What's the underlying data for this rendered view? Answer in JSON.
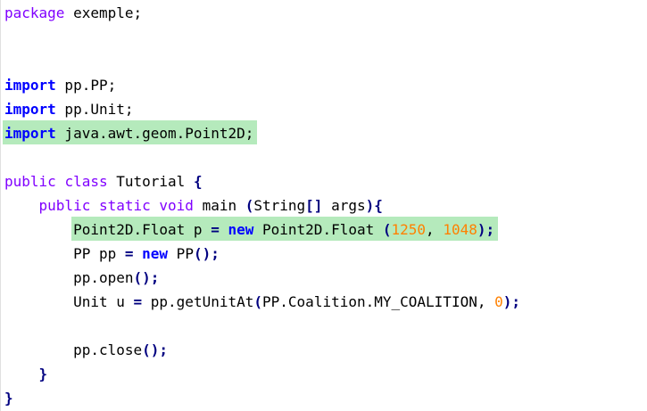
{
  "lines": [
    {
      "tokens": [
        {
          "t": "package",
          "c": "kw"
        },
        {
          "t": " exemple;",
          "c": "plain"
        }
      ]
    },
    {
      "tokens": []
    },
    {
      "tokens": []
    },
    {
      "tokens": [
        {
          "t": "import",
          "c": "kwb"
        },
        {
          "t": " pp.PP;",
          "c": "plain"
        }
      ]
    },
    {
      "tokens": [
        {
          "t": "import",
          "c": "kwb"
        },
        {
          "t": " pp.Unit;",
          "c": "plain"
        }
      ]
    },
    {
      "tokens": [
        {
          "t": "import",
          "c": "kwb"
        },
        {
          "t": " java.awt.geom.Point2D;",
          "c": "plain"
        }
      ]
    },
    {
      "tokens": []
    },
    {
      "tokens": [
        {
          "t": "public",
          "c": "kw"
        },
        {
          "t": " ",
          "c": "plain"
        },
        {
          "t": "class",
          "c": "kw"
        },
        {
          "t": " Tutorial ",
          "c": "plain"
        },
        {
          "t": "{",
          "c": "br"
        }
      ]
    },
    {
      "tokens": [
        {
          "t": "    ",
          "c": "plain"
        },
        {
          "t": "public",
          "c": "kw"
        },
        {
          "t": " ",
          "c": "plain"
        },
        {
          "t": "static",
          "c": "kw"
        },
        {
          "t": " ",
          "c": "plain"
        },
        {
          "t": "void",
          "c": "kw"
        },
        {
          "t": " main ",
          "c": "plain"
        },
        {
          "t": "(",
          "c": "br"
        },
        {
          "t": "String",
          "c": "plain"
        },
        {
          "t": "[]",
          "c": "br"
        },
        {
          "t": " args",
          "c": "plain"
        },
        {
          "t": "){",
          "c": "br"
        }
      ]
    },
    {
      "tokens": [
        {
          "t": "        Point2D.Float p ",
          "c": "plain"
        },
        {
          "t": "=",
          "c": "br"
        },
        {
          "t": " ",
          "c": "plain"
        },
        {
          "t": "new",
          "c": "kwb"
        },
        {
          "t": " Point2D.Float ",
          "c": "plain"
        },
        {
          "t": "(",
          "c": "br"
        },
        {
          "t": "1250",
          "c": "num"
        },
        {
          "t": ", ",
          "c": "plain"
        },
        {
          "t": "1048",
          "c": "num"
        },
        {
          "t": ");",
          "c": "br"
        }
      ]
    },
    {
      "tokens": [
        {
          "t": "        PP pp ",
          "c": "plain"
        },
        {
          "t": "=",
          "c": "br"
        },
        {
          "t": " ",
          "c": "plain"
        },
        {
          "t": "new",
          "c": "kwb"
        },
        {
          "t": " PP",
          "c": "plain"
        },
        {
          "t": "();",
          "c": "br"
        }
      ]
    },
    {
      "tokens": [
        {
          "t": "        pp.open",
          "c": "plain"
        },
        {
          "t": "();",
          "c": "br"
        }
      ]
    },
    {
      "tokens": [
        {
          "t": "        Unit u ",
          "c": "plain"
        },
        {
          "t": "=",
          "c": "br"
        },
        {
          "t": " pp.getUnitAt",
          "c": "plain"
        },
        {
          "t": "(",
          "c": "br"
        },
        {
          "t": "PP.Coalition.MY_COALITION, ",
          "c": "plain"
        },
        {
          "t": "0",
          "c": "num"
        },
        {
          "t": ");",
          "c": "br"
        }
      ]
    },
    {
      "tokens": []
    },
    {
      "tokens": [
        {
          "t": "        pp.close",
          "c": "plain"
        },
        {
          "t": "();",
          "c": "br"
        }
      ]
    },
    {
      "tokens": [
        {
          "t": "    ",
          "c": "plain"
        },
        {
          "t": "}",
          "c": "br"
        }
      ]
    },
    {
      "tokens": [
        {
          "t": "}",
          "c": "br"
        }
      ]
    }
  ],
  "highlighted_lines": [
    5,
    9
  ],
  "colors": {
    "keyword_purple": "#8000ff",
    "keyword_blue": "#0000ff",
    "number": "#ff8000",
    "brace": "#000080",
    "highlight": "#a8e6b0"
  }
}
